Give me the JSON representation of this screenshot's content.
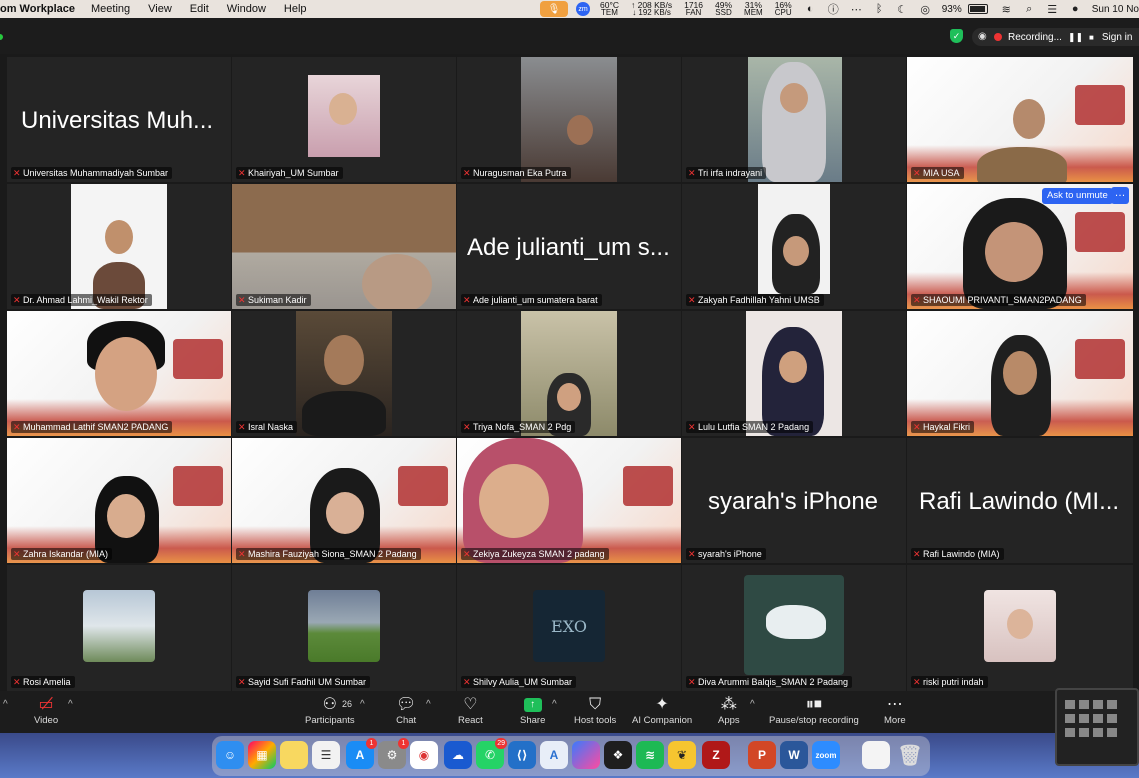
{
  "menubar": {
    "app_name": "om Workplace",
    "items": [
      "Meeting",
      "View",
      "Edit",
      "Window",
      "Help"
    ],
    "zm_label": "zm",
    "stats": [
      {
        "top": "60°C",
        "bottom": "TEM"
      },
      {
        "top": "↑ 208 KB/s",
        "bottom": "↓ 192 KB/s"
      },
      {
        "top": "1716",
        "bottom": "FAN"
      },
      {
        "top": "49%",
        "bottom": "SSD"
      },
      {
        "top": "31%",
        "bottom": "MEM"
      },
      {
        "top": "16%",
        "bottom": "CPU"
      }
    ],
    "battery": "93%",
    "date": "Sun 10 No"
  },
  "zoombar": {
    "recording_label": "Recording...",
    "signin_label": "Sign in"
  },
  "tiles": [
    {
      "name": "Universitas Muhammadiyah Sumbar",
      "big": "Universitas Muh..."
    },
    {
      "name": "Khairiyah_UM Sumbar"
    },
    {
      "name": "Nuragusman Eka Putra"
    },
    {
      "name": "Tri irfa indrayani"
    },
    {
      "name": "MIA USA"
    },
    {
      "name": "Dr. Ahmad Lahmi_Wakil Rektor"
    },
    {
      "name": "Sukiman Kadir"
    },
    {
      "name": "Ade julianti_um sumatera barat",
      "big": "Ade julianti_um s..."
    },
    {
      "name": "Zakyah Fadhillah Yahni UMSB"
    },
    {
      "name": "SHAOUMI PRIVANTI_SMAN2PADANG"
    },
    {
      "name": "Muhammad Lathif SMAN2 PADANG"
    },
    {
      "name": "Isral Naska"
    },
    {
      "name": "Triya Nofa_SMAN 2 Pdg"
    },
    {
      "name": "Lulu Lutfia SMAN 2 Padang"
    },
    {
      "name": "Haykal Fikri"
    },
    {
      "name": "Zahra Iskandar (MIA)"
    },
    {
      "name": "Mashira Fauziyah Siona_SMAN 2 Padang"
    },
    {
      "name": "Zekiya Zukeyza SMAN 2 padang"
    },
    {
      "name": "syarah's iPhone",
      "big": "syarah's iPhone"
    },
    {
      "name": "Rafi Lawindo (MIA)",
      "big": "Rafi Lawindo (MI..."
    },
    {
      "name": "Rosi Amelia"
    },
    {
      "name": "Sayid Sufi Fadhil UM Sumbar"
    },
    {
      "name": "Shilvy Aulia_UM Sumbar"
    },
    {
      "name": "Diva Arummi Balqis_SMAN 2 Padang"
    },
    {
      "name": "riski putri indah"
    }
  ],
  "ask_to_unmute": "Ask to unmute",
  "exo_text": "EXO",
  "toolbar": {
    "video": "Video",
    "participants": "Participants",
    "participants_count": "26",
    "chat": "Chat",
    "react": "React",
    "share": "Share",
    "host_tools": "Host tools",
    "ai_companion": "AI Companion",
    "apps": "Apps",
    "pause_recording": "Pause/stop recording",
    "more": "More"
  },
  "dock": {
    "badges": {
      "appstore": "1",
      "settings": "1",
      "whatsapp": "29"
    },
    "zoom_label": "zoom"
  }
}
